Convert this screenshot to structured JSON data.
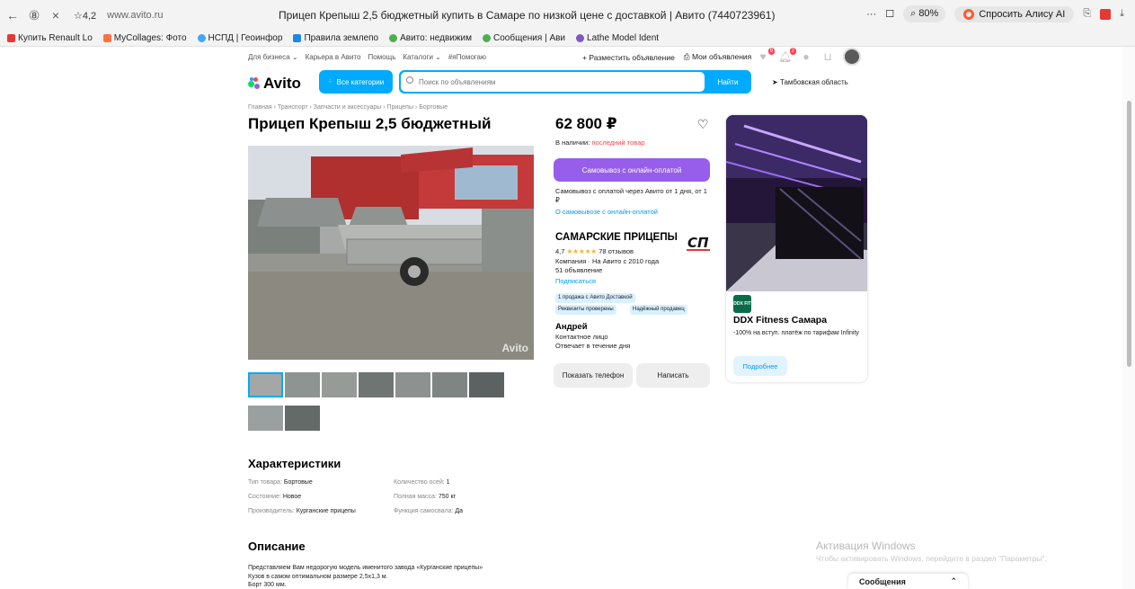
{
  "browser": {
    "back": "←",
    "yandex": "⑧",
    "close": "×",
    "rating": "☆4,2",
    "url": "www.avito.ru",
    "page_title": "Прицеп Крепыш 2,5 бюджетный купить в Самаре по низкой цене с доставкой | Авито (7440723961)",
    "zoom": "80%",
    "alice": "Спросить Алису AI"
  },
  "bookmarks": [
    {
      "label": "Купить Renault Lo",
      "color": "#e53935"
    },
    {
      "label": "MyCollages: Фото",
      "color": "#ff7043"
    },
    {
      "label": "НСПД | Геоинфор",
      "color": "#42a5f5"
    },
    {
      "label": "Правила землепо",
      "color": "#1e88e5"
    },
    {
      "label": "Авито: недвижим",
      "color": "#4caf50"
    },
    {
      "label": "Сообщения | Ави",
      "color": "#4caf50"
    },
    {
      "label": "Lathe Model Ident",
      "color": "#7e57c2"
    }
  ],
  "avito": {
    "top_links": [
      "Для бизнеса ⌄",
      "Карьера в Авито",
      "Помощь",
      "Каталоги ⌄",
      "#яПомогаю"
    ],
    "post_ad": "+ Разместить объявление",
    "my_ads": "⎙ Мои объявления",
    "badges": [
      "9",
      "2"
    ],
    "logo": "Avito",
    "categories_btn": "Все категории",
    "search_placeholder": "Поиск по объявлениям",
    "find_btn": "Найти",
    "region": "Тамбовская область"
  },
  "listing": {
    "breadcrumb": "Главная › Транспорт › Запчасти и аксессуары › Прицепы › Бортовые",
    "title": "Прицеп Крепыш 2,5 бюджетный",
    "price": "62 800 ₽",
    "stock_label": "В наличии: ",
    "stock_value": "последний товар",
    "pickup_btn": "Самовывоз с онлайн-оплатой",
    "pickup_text": "Самовывоз с оплатой через Авито от 1 дня, от 1 ₽",
    "pickup_link": "О самовывозе с онлайн-оплатой",
    "watermark": "Avito"
  },
  "seller": {
    "name": "САМАРСКИЕ ПРИЦЕПЫ",
    "rating": "4,7",
    "stars": "★★★★★",
    "reviews": "78 отзывов",
    "company": "Компания · На Авито с 2010 года",
    "ads": "51 объявление",
    "subscribe": "Подписаться",
    "chips": [
      "1 продажа с Авито Доставкой",
      "Реквизиты проверены",
      "Надёжный продавец"
    ],
    "contact_name": "Андрей",
    "contact_role": "Контактное лицо",
    "response": "Отвечает в течение дня",
    "show_phone": "Показать телефон",
    "write": "Написать",
    "logo_text": "СП"
  },
  "ad": {
    "logo_text": "DDX FIT",
    "title": "DDX Fitness Самара",
    "text": "-100% на вступ. платёж по тарифам Infinity",
    "more": "Подробнее"
  },
  "characteristics": {
    "title": "Характеристики",
    "left": [
      {
        "k": "Тип товара: ",
        "v": "Бортовые"
      },
      {
        "k": "Состояние: ",
        "v": "Новое"
      },
      {
        "k": "Производитель: ",
        "v": "Курганские прицепы"
      }
    ],
    "right": [
      {
        "k": "Количество осей: ",
        "v": "1"
      },
      {
        "k": "Полная масса: ",
        "v": "750 кг"
      },
      {
        "k": "Функция самосвала: ",
        "v": "Да"
      }
    ]
  },
  "description": {
    "title": "Описание",
    "lines": [
      "Представляем Вам недорогую модель именитого завода «Курганские прицепы»",
      "Кузов в самом оптимальном размере 2,5х1,3 м.",
      "Борт 300 мм."
    ]
  },
  "windows": {
    "line1": "Активация Windows",
    "line2": "Чтобы активировать Windows, перейдите в раздел \"Параметры\"."
  },
  "messages": {
    "label": "Сообщения",
    "chevron": "⌃"
  },
  "colors": {
    "avito_blue": "#00aaff",
    "pickup_purple": "#965eeb",
    "red": "#ff4053",
    "link_blue": "#0099f7"
  }
}
